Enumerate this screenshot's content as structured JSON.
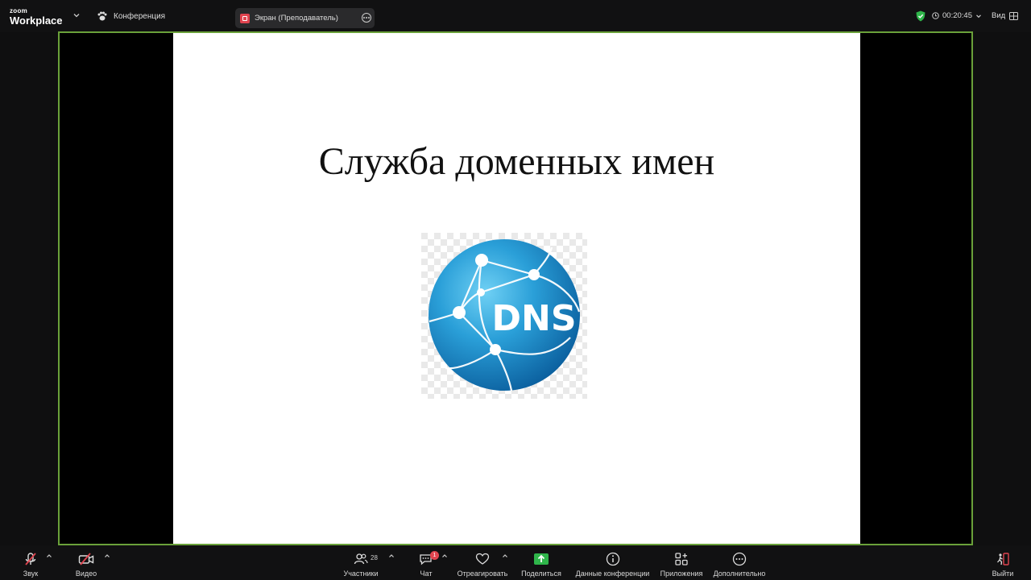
{
  "app": {
    "logo_small": "zoom",
    "logo_big": "Workplace",
    "conference_label": "Конференция",
    "share_label": "Экран (Преподаватель)",
    "timer": "00:20:45",
    "view_label": "Вид"
  },
  "slide": {
    "title": "Служба доменных имен",
    "logo_text": "DNS"
  },
  "toolbar": {
    "audio": "Звук",
    "video": "Видео",
    "participants": "Участники",
    "participants_count": "28",
    "chat": "Чат",
    "chat_badge": "1",
    "react": "Отреагировать",
    "share": "Поделиться",
    "info": "Данные конференции",
    "apps": "Приложения",
    "more": "Дополнительно",
    "leave": "Выйти"
  },
  "colors": {
    "stage_border": "#6aa13a",
    "share_green": "#2fb54a",
    "alert_red": "#e0444f"
  }
}
